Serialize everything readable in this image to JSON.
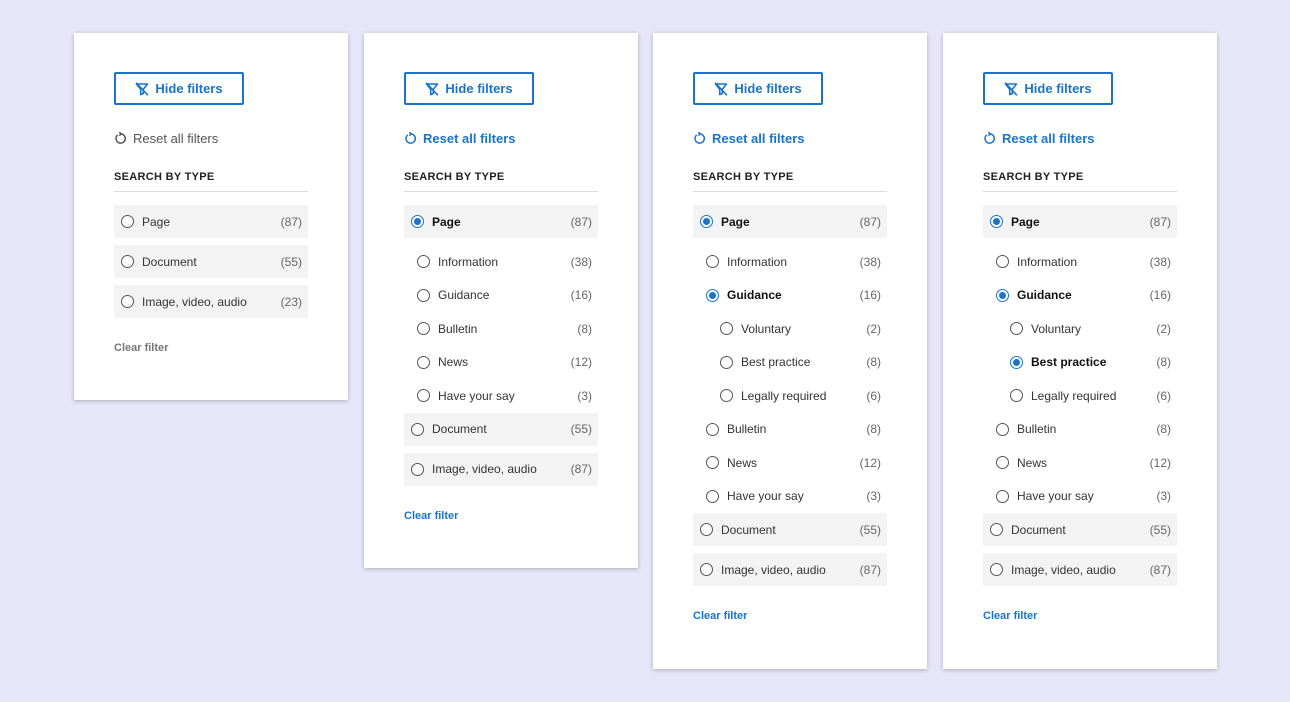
{
  "colors": {
    "accent": "#1a74c9",
    "background": "#e6e6f8"
  },
  "icons": {
    "hide": "filter-off-icon",
    "reset": "reset-icon"
  },
  "panels": [
    {
      "hide_label": "Hide filters",
      "reset_label": "Reset all filters",
      "reset_enabled": false,
      "section_title": "SEARCH BY TYPE",
      "items": [
        {
          "label": "Page",
          "count": "(87)",
          "level": 0,
          "selected": false
        },
        {
          "label": "Document",
          "count": "(55)",
          "level": 0,
          "selected": false
        },
        {
          "label": "Image, video, audio",
          "count": "(23)",
          "level": 0,
          "selected": false
        }
      ],
      "clear_label": "Clear filter",
      "clear_enabled": false
    },
    {
      "hide_label": "Hide filters",
      "reset_label": "Reset all filters",
      "reset_enabled": true,
      "section_title": "SEARCH BY TYPE",
      "items": [
        {
          "label": "Page",
          "count": "(87)",
          "level": 0,
          "selected": true
        },
        {
          "label": "Information",
          "count": "(38)",
          "level": 1,
          "selected": false
        },
        {
          "label": "Guidance",
          "count": "(16)",
          "level": 1,
          "selected": false
        },
        {
          "label": "Bulletin",
          "count": "(8)",
          "level": 1,
          "selected": false
        },
        {
          "label": "News",
          "count": "(12)",
          "level": 1,
          "selected": false
        },
        {
          "label": "Have your say",
          "count": "(3)",
          "level": 1,
          "selected": false
        },
        {
          "label": "Document",
          "count": "(55)",
          "level": 0,
          "selected": false
        },
        {
          "label": "Image, video, audio",
          "count": "(87)",
          "level": 0,
          "selected": false
        }
      ],
      "clear_label": "Clear filter",
      "clear_enabled": true
    },
    {
      "hide_label": "Hide filters",
      "reset_label": "Reset all filters",
      "reset_enabled": true,
      "section_title": "SEARCH BY TYPE",
      "items": [
        {
          "label": "Page",
          "count": "(87)",
          "level": 0,
          "selected": true
        },
        {
          "label": "Information",
          "count": "(38)",
          "level": 1,
          "selected": false
        },
        {
          "label": "Guidance",
          "count": "(16)",
          "level": 1,
          "selected": true
        },
        {
          "label": "Voluntary",
          "count": "(2)",
          "level": 2,
          "selected": false
        },
        {
          "label": "Best practice",
          "count": "(8)",
          "level": 2,
          "selected": false
        },
        {
          "label": "Legally required",
          "count": "(6)",
          "level": 2,
          "selected": false
        },
        {
          "label": "Bulletin",
          "count": "(8)",
          "level": 1,
          "selected": false
        },
        {
          "label": "News",
          "count": "(12)",
          "level": 1,
          "selected": false
        },
        {
          "label": "Have your say",
          "count": "(3)",
          "level": 1,
          "selected": false
        },
        {
          "label": "Document",
          "count": "(55)",
          "level": 0,
          "selected": false
        },
        {
          "label": "Image, video, audio",
          "count": "(87)",
          "level": 0,
          "selected": false
        }
      ],
      "clear_label": "Clear filter",
      "clear_enabled": true
    },
    {
      "hide_label": "Hide filters",
      "reset_label": "Reset all filters",
      "reset_enabled": true,
      "section_title": "SEARCH BY TYPE",
      "items": [
        {
          "label": "Page",
          "count": "(87)",
          "level": 0,
          "selected": true
        },
        {
          "label": "Information",
          "count": "(38)",
          "level": 1,
          "selected": false
        },
        {
          "label": "Guidance",
          "count": "(16)",
          "level": 1,
          "selected": true
        },
        {
          "label": "Voluntary",
          "count": "(2)",
          "level": 2,
          "selected": false
        },
        {
          "label": "Best practice",
          "count": "(8)",
          "level": 2,
          "selected": true
        },
        {
          "label": "Legally required",
          "count": "(6)",
          "level": 2,
          "selected": false
        },
        {
          "label": "Bulletin",
          "count": "(8)",
          "level": 1,
          "selected": false
        },
        {
          "label": "News",
          "count": "(12)",
          "level": 1,
          "selected": false
        },
        {
          "label": "Have your say",
          "count": "(3)",
          "level": 1,
          "selected": false
        },
        {
          "label": "Document",
          "count": "(55)",
          "level": 0,
          "selected": false
        },
        {
          "label": "Image, video, audio",
          "count": "(87)",
          "level": 0,
          "selected": false
        }
      ],
      "clear_label": "Clear filter",
      "clear_enabled": true
    }
  ]
}
